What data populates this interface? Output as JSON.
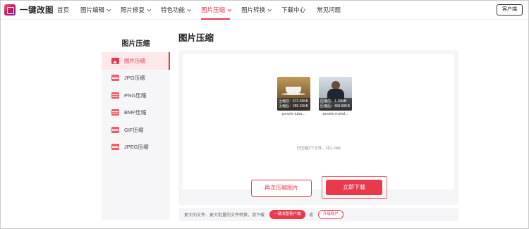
{
  "app": {
    "name": "一键改图"
  },
  "nav": {
    "items": [
      {
        "label": "首页",
        "has_dropdown": false,
        "active": false
      },
      {
        "label": "图片编辑",
        "has_dropdown": true,
        "active": false
      },
      {
        "label": "照片修复",
        "has_dropdown": true,
        "active": false
      },
      {
        "label": "特色功能",
        "has_dropdown": true,
        "active": false
      },
      {
        "label": "图片压缩",
        "has_dropdown": true,
        "active": true
      },
      {
        "label": "图片转换",
        "has_dropdown": true,
        "active": false
      },
      {
        "label": "下载中心",
        "has_dropdown": false,
        "active": false
      },
      {
        "label": "常见问题",
        "has_dropdown": false,
        "active": false
      }
    ],
    "client_button": "客户端"
  },
  "sidebar": {
    "title": "图片压缩",
    "items": [
      {
        "label": "图片压缩",
        "icon": "image-icon",
        "active": true
      },
      {
        "label": "JPG压缩",
        "icon": "format-icon",
        "active": false
      },
      {
        "label": "PNG压缩",
        "icon": "format-icon",
        "active": false
      },
      {
        "label": "BMP压缩",
        "icon": "format-icon",
        "active": false
      },
      {
        "label": "GIF压缩",
        "icon": "format-icon",
        "active": false
      },
      {
        "label": "JPEG压缩",
        "icon": "format-icon",
        "active": false
      }
    ]
  },
  "main": {
    "title": "图片压缩",
    "files": [
      {
        "before": "压缩前：573.39KB",
        "after": "压缩后：285.33KB",
        "name": "pexels-juba..."
      },
      {
        "before": "压缩前：1.18MB",
        "after": "压缩后：468.80KB",
        "name": "pexels-mahd..."
      }
    ],
    "summary": "已压缩2个文件，共0.74M",
    "compress_again_button": "再次压缩图片",
    "download_button": "立即下载"
  },
  "footer": {
    "text": "更大的文件、更大批量的文件转换，请下载",
    "client_button": "一键改图客户端",
    "or_text": "或",
    "upgrade_button": "升级账户"
  },
  "colors": {
    "accent": "#e8394d",
    "panel_bg": "#f5f5f7"
  }
}
